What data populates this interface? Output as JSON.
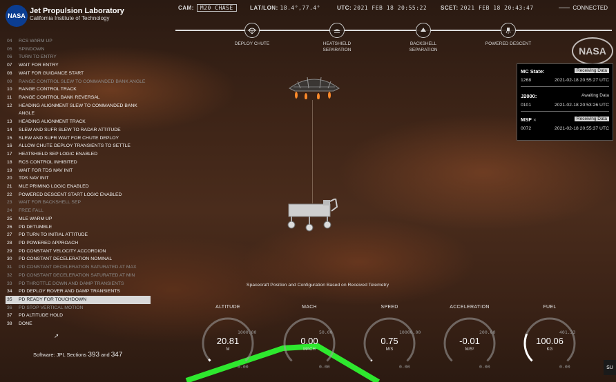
{
  "header": {
    "org_name": "Jet Propulsion Laboratory",
    "org_sub": "California Institute of Technology",
    "logo_text": "NASA",
    "cam_label": "CAM:",
    "cam_value": "M20 CHASE",
    "latlon_label": "LAT/LON:",
    "latlon_value": "18.4°,77.4°",
    "utc_label": "UTC:",
    "utc_value": "2021 FEB 18 20:55:22",
    "scet_label": "SCET:",
    "scet_value": "2021 FEB 18 20:43:47",
    "connection": "CONNECTED"
  },
  "phases": [
    {
      "label": "DEPLOY CHUTE",
      "icon": "parachute-icon"
    },
    {
      "label": "HEATSHIELD SEPARATION",
      "icon": "heatshield-icon"
    },
    {
      "label": "BACKSHELL SEPARATION",
      "icon": "backshell-icon"
    },
    {
      "label": "POWERED DESCENT",
      "icon": "descent-stage-icon"
    }
  ],
  "events": [
    {
      "n": "04",
      "label": "RCS WARM UP",
      "state": "dim"
    },
    {
      "n": "05",
      "label": "SPINDOWN",
      "state": "dim"
    },
    {
      "n": "06",
      "label": "TURN TO ENTRY",
      "state": "dim"
    },
    {
      "n": "07",
      "label": "WAIT FOR ENTRY",
      "state": "on"
    },
    {
      "n": "08",
      "label": "WAIT FOR GUIDANCE START",
      "state": "on"
    },
    {
      "n": "09",
      "label": "RANGE CONTROL SLEW TO COMMANDED BANK ANGLE",
      "state": "dim"
    },
    {
      "n": "10",
      "label": "RANGE CONTROL TRACK",
      "state": "on"
    },
    {
      "n": "11",
      "label": "RANGE CONTROL BANK REVERSAL",
      "state": "on"
    },
    {
      "n": "12",
      "label": "HEADING ALIGNMENT SLEW TO COMMANDED BANK",
      "state": "on"
    },
    {
      "n": "",
      "label": "ANGLE",
      "state": "on"
    },
    {
      "n": "13",
      "label": "HEADING ALIGNMENT TRACK",
      "state": "on"
    },
    {
      "n": "14",
      "label": "SLEW AND SUFR SLEW TO RADAR ATTITUDE",
      "state": "on"
    },
    {
      "n": "15",
      "label": "SLEW AND SUFR WAIT FOR CHUTE DEPLOY",
      "state": "on"
    },
    {
      "n": "16",
      "label": "ALLOW CHUTE DEPLOY TRANSIENTS TO SETTLE",
      "state": "on"
    },
    {
      "n": "17",
      "label": "HEATSHIELD SEP LOGIC ENABLED",
      "state": "on"
    },
    {
      "n": "18",
      "label": "RCS CONTROL INHIBITED",
      "state": "on"
    },
    {
      "n": "19",
      "label": "WAIT FOR TDS NAV INIT",
      "state": "on"
    },
    {
      "n": "20",
      "label": "TDS NAV INIT",
      "state": "on"
    },
    {
      "n": "21",
      "label": "MLE PRIMING LOGIC ENABLED",
      "state": "on"
    },
    {
      "n": "22",
      "label": "POWERED DESCENT START LOGIC ENABLED",
      "state": "on"
    },
    {
      "n": "23",
      "label": "WAIT FOR BACKSHELL SEP",
      "state": "dim"
    },
    {
      "n": "24",
      "label": "FREE FALL",
      "state": "dim"
    },
    {
      "n": "25",
      "label": "MLE WARM UP",
      "state": "on"
    },
    {
      "n": "26",
      "label": "PD DETUMBLE",
      "state": "on"
    },
    {
      "n": "27",
      "label": "PD TURN TO INITIAL ATTITUDE",
      "state": "on"
    },
    {
      "n": "28",
      "label": "PD POWERED APPROACH",
      "state": "on"
    },
    {
      "n": "29",
      "label": "PD CONSTANT VELOCITY ACCORDION",
      "state": "on"
    },
    {
      "n": "30",
      "label": "PD CONSTANT DECELERATION NOMINAL",
      "state": "on"
    },
    {
      "n": "31",
      "label": "PD CONSTANT DECELERATION SATURATED AT MAX",
      "state": "dim"
    },
    {
      "n": "32",
      "label": "PD CONSTANT DECELERATION SATURATED AT MIN",
      "state": "dim"
    },
    {
      "n": "33",
      "label": "PD THROTTLE DOWN AND DAMP TRANSIENTS",
      "state": "dim"
    },
    {
      "n": "34",
      "label": "PD DEPLOY ROVER AND DAMP TRANSIENTS",
      "state": "on"
    },
    {
      "n": "35",
      "label": "PD READY FOR TOUCHDOWN",
      "state": "sel"
    },
    {
      "n": "36",
      "label": "PD STOP VERTICAL MOTION",
      "state": "dim"
    },
    {
      "n": "37",
      "label": "PD ALTITUDE HOLD",
      "state": "on"
    },
    {
      "n": "38",
      "label": "DONE",
      "state": "on"
    }
  ],
  "software": {
    "prefix": "Software: JPL Sections",
    "a": "393",
    "and": "and",
    "b": "347"
  },
  "status": {
    "mc": {
      "name": "MC State:",
      "badge": "Receiving Data",
      "left": "1268",
      "right": "2021-02-18 20:55:27 UTC"
    },
    "j2000": {
      "name": "J2000:",
      "badge": "Awaiting Data",
      "left": "0101",
      "right": "2021-02-18 20:53:26 UTC"
    },
    "msf": {
      "name": "MSF",
      "badge": "Receiving Data",
      "left": "0072",
      "right": "2021-02-18 20:55:37 UTC"
    }
  },
  "watermark": "NASA",
  "caption": "Spacecraft Position and Configuration Based on Received Telemetry",
  "gauges": [
    {
      "label": "ALTITUDE",
      "value": "20.81",
      "unit": "M",
      "max": "1000.00",
      "min": "0.00",
      "fraction": 0.02
    },
    {
      "label": "MACH",
      "value": "0.00",
      "unit": "MACH",
      "max": "50.00",
      "min": "0.00",
      "fraction": 0.0
    },
    {
      "label": "SPEED",
      "value": "0.75",
      "unit": "M/S",
      "max": "10000.00",
      "min": "0.00",
      "fraction": 0.01
    },
    {
      "label": "ACCELERATION",
      "value": "-0.01",
      "unit": "M/S²",
      "max": "200.00",
      "min": "0.00",
      "fraction": 0.0
    },
    {
      "label": "FUEL",
      "value": "100.06",
      "unit": "KG",
      "max": "401.33",
      "min": "0.00",
      "fraction": 0.25
    }
  ],
  "overlay_color": "#2ee82e",
  "corner_badge": "SU"
}
